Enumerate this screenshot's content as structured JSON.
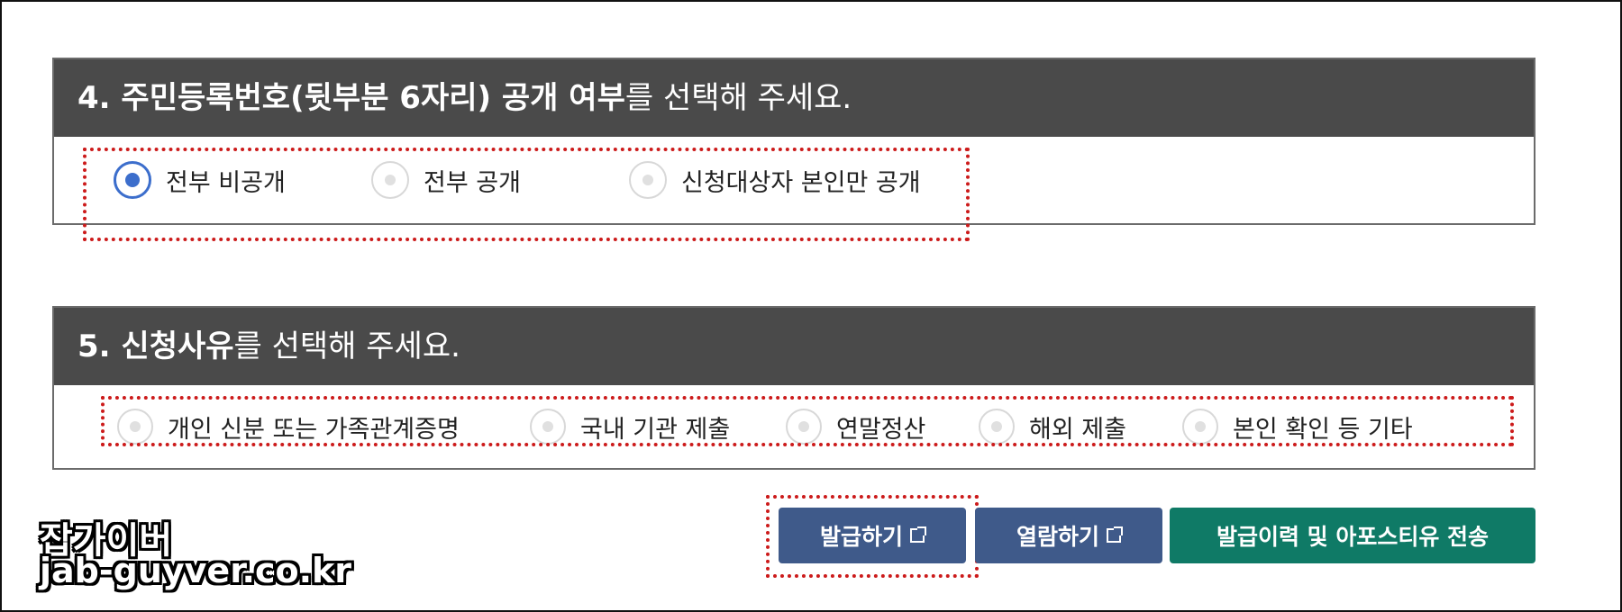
{
  "section4": {
    "title_strong": "4. 주민등록번호(뒷부분 6자리) 공개 여부",
    "title_rest": "를 선택해 주세요.",
    "options": [
      "전부 비공개",
      "전부 공개",
      "신청대상자 본인만 공개"
    ],
    "selected_index": 0
  },
  "section5": {
    "title_strong": "5. 신청사유",
    "title_rest": "를 선택해 주세요.",
    "options": [
      "개인 신분 또는 가족관계증명",
      "국내 기관 제출",
      "연말정산",
      "해외 제출",
      "본인 확인 등 기타"
    ]
  },
  "buttons": {
    "issue": "발급하기",
    "view": "열람하기",
    "history": "발급이력 및 아포스티유 전송"
  },
  "watermark": {
    "name": "잡가이버",
    "domain": "jab-guyver.co.kr"
  },
  "colors": {
    "header_bg": "#4a4a4a",
    "radio_selected": "#3c6ecc",
    "button_blue": "#3f5a8a",
    "button_green": "#0f7a66",
    "highlight_red": "#cc1b1b"
  },
  "icons": {
    "external_link": "external-link-icon",
    "radio": "radio-circle-icon"
  }
}
